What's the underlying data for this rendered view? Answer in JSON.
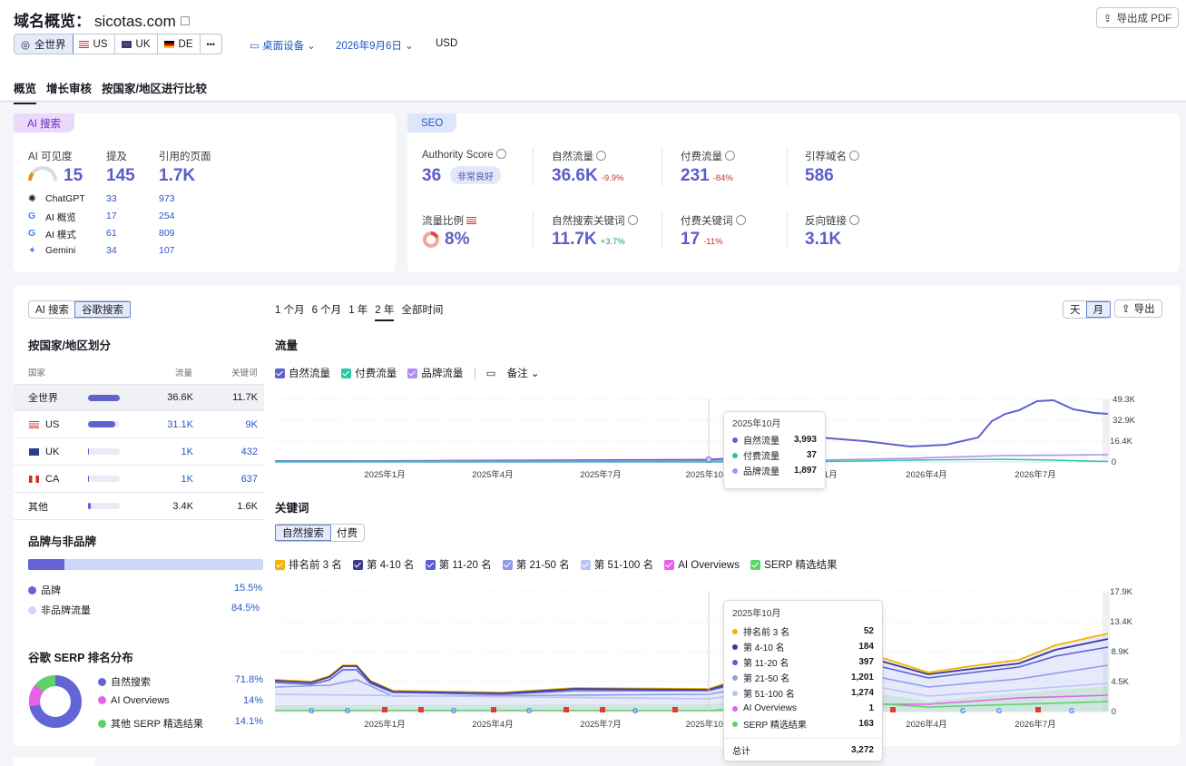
{
  "header": {
    "title": "域名概览：",
    "domain": "sicotas.com",
    "export_pdf": "导出成 PDF",
    "regions": [
      "全世界",
      "US",
      "UK",
      "DE"
    ],
    "more": "•••",
    "device": "桌面设备",
    "date": "2026年9月6日",
    "currency": "USD"
  },
  "tabs": [
    "概览",
    "增长审核",
    "按国家/地区进行比较"
  ],
  "ai_card": {
    "badge": "AI 搜索",
    "visibility_label": "AI 可见度",
    "visibility": "15",
    "mentions_label": "提及",
    "mentions": "145",
    "cited_label": "引用的页面",
    "cited": "1.7K",
    "rows": [
      {
        "name": "ChatGPT",
        "mentions": "33",
        "cited": "973"
      },
      {
        "name": "AI 概览",
        "mentions": "17",
        "cited": "254"
      },
      {
        "name": "AI 模式",
        "mentions": "61",
        "cited": "809"
      },
      {
        "name": "Gemini",
        "mentions": "34",
        "cited": "107"
      }
    ]
  },
  "seo_card": {
    "badge": "SEO",
    "authority_label": "Authority Score",
    "authority": "36",
    "authority_badge": "非常良好",
    "organic_label": "自然流量",
    "organic": "36.6K",
    "organic_chg": "-9.9%",
    "paid_label": "付费流量",
    "paid": "231",
    "paid_chg": "-84%",
    "refdomains_label": "引荐域名",
    "refdomains": "586",
    "share_label": "流量比例",
    "share": "8%",
    "org_kw_label": "自然搜索关键词",
    "org_kw": "11.7K",
    "org_kw_chg": "+3.7%",
    "paid_kw_label": "付费关键词",
    "paid_kw": "17",
    "paid_kw_chg": "-11%",
    "backlinks_label": "反向链接",
    "backlinks": "3.1K"
  },
  "left": {
    "toggle": [
      "AI 搜索",
      "谷歌搜索"
    ],
    "country_title": "按国家/地区划分",
    "cols": [
      "国家",
      "流量",
      "关键词"
    ],
    "countries": [
      {
        "name": "全世界",
        "traffic": "36.6K",
        "kw": "11.7K",
        "share": 1.0
      },
      {
        "name": "US",
        "traffic": "31.1K",
        "kw": "9K",
        "share": 0.85
      },
      {
        "name": "UK",
        "traffic": "1K",
        "kw": "432",
        "share": 0.03
      },
      {
        "name": "CA",
        "traffic": "1K",
        "kw": "637",
        "share": 0.03
      },
      {
        "name": "其他",
        "traffic": "3.4K",
        "kw": "1.6K",
        "share": 0.09
      }
    ],
    "brand_title": "品牌与非品牌",
    "brand_label": "品牌",
    "brand_pct": "15.5%",
    "nonbrand_label": "非品牌流量",
    "nonbrand_pct": "84.5%",
    "serp_title": "谷歌 SERP 排名分布",
    "serp": [
      {
        "name": "自然搜索",
        "pct": "71.8%",
        "color": "#6364d5"
      },
      {
        "name": "AI Overviews",
        "pct": "14%",
        "color": "#e760ea"
      },
      {
        "name": "其他 SERP 精选结果",
        "pct": "14.1%",
        "color": "#5fd268"
      }
    ]
  },
  "main": {
    "periods": [
      "1 个月",
      "6 个月",
      "1 年",
      "2 年",
      "全部时间"
    ],
    "day": "天",
    "month": "月",
    "export": "导出",
    "traffic_title": "流量",
    "traffic_legend": [
      "自然流量",
      "付费流量",
      "品牌流量"
    ],
    "notes": "备注",
    "kw_title": "关键词",
    "kw_toggle": [
      "自然搜索",
      "付费"
    ],
    "kw_legend": [
      "排名前 3 名",
      "第 4-10 名",
      "第 11-20 名",
      "第 21-50 名",
      "第 51-100 名",
      "AI Overviews",
      "SERP 精选结果"
    ]
  },
  "chart_data": [
    {
      "type": "line",
      "title": "流量",
      "x": [
        "2025年1月",
        "2025年4月",
        "2025年7月",
        "2025年10月",
        "2026年1月",
        "2026年4月",
        "2026年7月"
      ],
      "yticks": [
        "49.3K",
        "32.9K",
        "16.4K",
        "0"
      ],
      "series": [
        {
          "name": "自然流量",
          "values": [
            2000,
            2200,
            2800,
            3993,
            12000,
            13000,
            36600
          ]
        },
        {
          "name": "付费流量",
          "values": [
            30,
            30,
            35,
            37,
            400,
            1200,
            231
          ]
        },
        {
          "name": "品牌流量",
          "values": [
            1500,
            1600,
            1800,
            1897,
            2500,
            3500,
            4000
          ]
        }
      ],
      "tooltip": {
        "date": "2025年10月",
        "rows": [
          {
            "name": "自然流量",
            "value": "3,993"
          },
          {
            "name": "付费流量",
            "value": "37"
          },
          {
            "name": "品牌流量",
            "value": "1,897"
          }
        ]
      }
    },
    {
      "type": "area",
      "title": "关键词",
      "x": [
        "2025年1月",
        "2025年4月",
        "2025年7月",
        "2025年10月",
        "2026年1月",
        "2026年4月",
        "2026年7月"
      ],
      "yticks": [
        "17.9K",
        "13.4K",
        "8.9K",
        "4.5K",
        "0"
      ],
      "tooltip": {
        "date": "2025年10月",
        "rows": [
          {
            "name": "排名前 3 名",
            "value": "52",
            "color": "#f4b400"
          },
          {
            "name": "第 4-10 名",
            "value": "184",
            "color": "#3c3a8f"
          },
          {
            "name": "第 11-20 名",
            "value": "397",
            "color": "#5c5ed2"
          },
          {
            "name": "第 21-50 名",
            "value": "1,201",
            "color": "#8e9ce8"
          },
          {
            "name": "第 51-100 名",
            "value": "1,274",
            "color": "#b9c4f3"
          },
          {
            "name": "AI Overviews",
            "value": "1",
            "color": "#e760ea"
          },
          {
            "name": "SERP 精选结果",
            "value": "163",
            "color": "#5fd268"
          }
        ],
        "total_label": "总计",
        "total": "3,272"
      }
    }
  ]
}
